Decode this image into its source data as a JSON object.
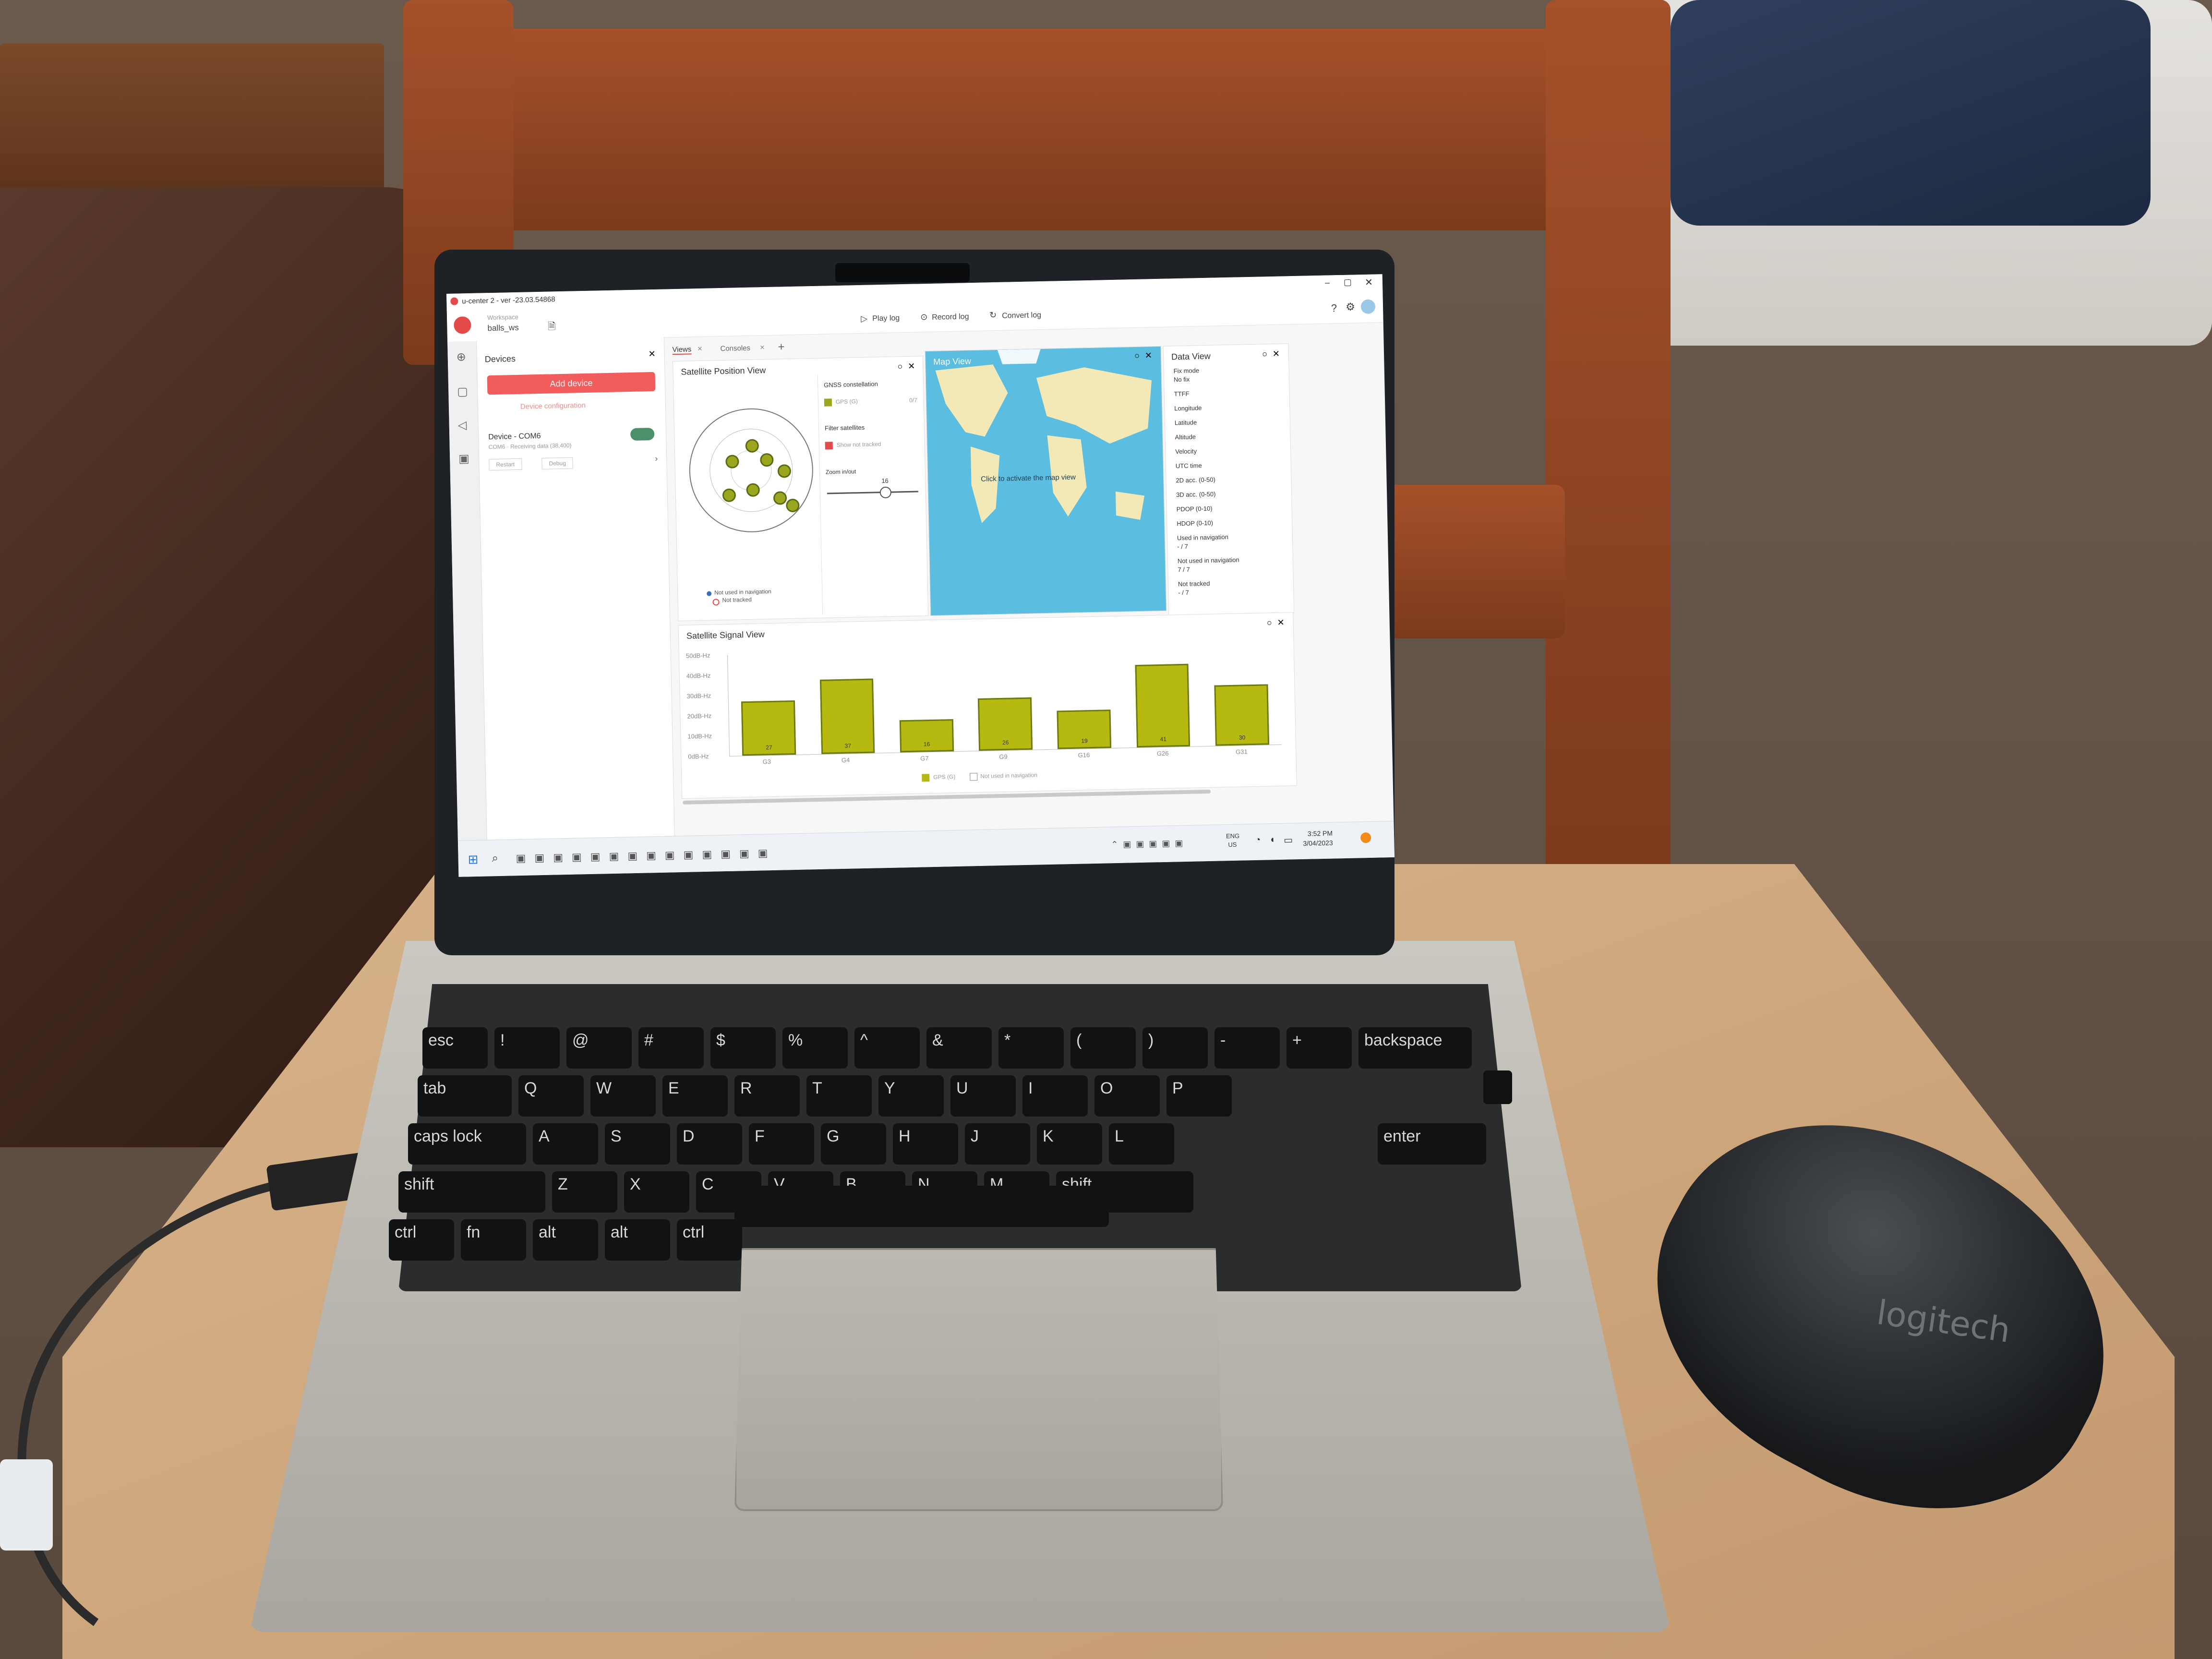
{
  "app": {
    "title": "u-center 2 - ver -23.03.54868",
    "workspace_label": "Workspace",
    "workspace_name": "balls_ws"
  },
  "toolbar": {
    "play_log": "Play log",
    "record_log": "Record log",
    "convert_log": "Convert log"
  },
  "devices": {
    "title": "Devices",
    "add_device": "Add device",
    "device_configuration": "Device configuration",
    "device_name": "Device - COM6",
    "device_status": "COM6 · Receiving data (38,400)",
    "restart": "Restart",
    "debug": "Debug"
  },
  "tabs": [
    {
      "label": "Views"
    },
    {
      "label": "Consoles"
    }
  ],
  "sat_position_view": {
    "title": "Satellite Position View",
    "gnss_constellation": "GNSS constellation",
    "gps_label": "GPS (G)",
    "gps_count": "0/7",
    "filter_satellites": "Filter satellites",
    "show_not_tracked": "Show not tracked",
    "zoom_label": "Zoom in/out",
    "zoom_value": "16",
    "legend_not_used": "Not used in navigation",
    "legend_not_tracked": "Not tracked"
  },
  "map_view": {
    "title": "Map View",
    "prompt": "Click to activate the map view"
  },
  "data_view": {
    "title": "Data View",
    "fields": [
      {
        "label": "Fix mode",
        "value": "No fix"
      },
      {
        "label": "TTFF",
        "value": ""
      },
      {
        "label": "Longitude",
        "value": ""
      },
      {
        "label": "Latitude",
        "value": ""
      },
      {
        "label": "Altitude",
        "value": ""
      },
      {
        "label": "Velocity",
        "value": ""
      },
      {
        "label": "UTC time",
        "value": ""
      },
      {
        "label": "2D acc. (0-50)",
        "value": ""
      },
      {
        "label": "3D acc. (0-50)",
        "value": ""
      },
      {
        "label": "PDOP (0-10)",
        "value": ""
      },
      {
        "label": "HDOP (0-10)",
        "value": ""
      },
      {
        "label": "Used in navigation",
        "value": "- / 7"
      },
      {
        "label": "Not used in navigation",
        "value": "7 / 7"
      },
      {
        "label": "Not tracked",
        "value": "- / 7"
      }
    ]
  },
  "signal_view": {
    "title": "Satellite Signal View",
    "legend_gps": "GPS (G)",
    "legend_not_used": "Not used in navigation"
  },
  "chart_data": {
    "type": "bar",
    "title": "Satellite Signal View",
    "categories": [
      "G3",
      "G4",
      "G7",
      "G9",
      "G16",
      "G26",
      "G31"
    ],
    "values": [
      27,
      37,
      16,
      26,
      19,
      41,
      30
    ],
    "ylim": [
      0,
      50
    ],
    "yticks": [
      "50dB-Hz",
      "40dB-Hz",
      "30dB-Hz",
      "20dB-Hz",
      "10dB-Hz",
      "0dB-Hz"
    ],
    "series": [
      {
        "name": "GPS (G)",
        "color": "#b6ba10"
      }
    ]
  },
  "taskbar": {
    "lang": "ENG",
    "region": "US",
    "time": "3:52 PM",
    "date": "3/04/2023"
  },
  "keyboard": {
    "keys_row1": [
      "esc",
      "!",
      "@",
      "#",
      "$",
      "%",
      "^",
      "&",
      "*",
      "(",
      ")",
      "-",
      "+",
      "backspace"
    ],
    "letters": [
      "tab",
      "Q",
      "W",
      "E",
      "R",
      "T",
      "Y",
      "U",
      "I",
      "O",
      "P",
      "caps lock",
      "A",
      "S",
      "D",
      "F",
      "G",
      "H",
      "J",
      "K",
      "L",
      "enter",
      "shift",
      "Z",
      "X",
      "C",
      "V",
      "B",
      "N",
      "M",
      "shift",
      "ctrl",
      "fn",
      "alt",
      "alt",
      "ctrl"
    ]
  },
  "mouse_brand": "logitech",
  "colors": {
    "accent_red": "#f25c5c",
    "gps_bar": "#b6ba10",
    "toggle_green": "#4b8f6b"
  }
}
